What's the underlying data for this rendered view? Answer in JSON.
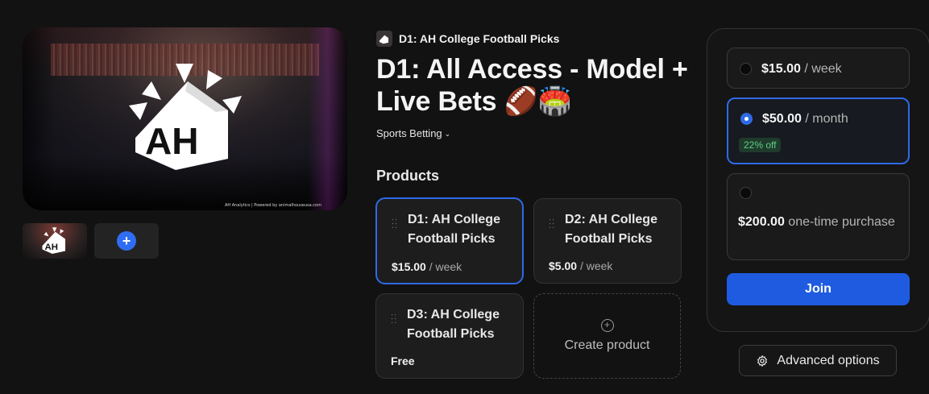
{
  "media": {
    "hero_caption": "AH Analytics | Powered by animalhouseusa.com",
    "hero_logo_text": "AH"
  },
  "brand": {
    "name": "D1: AH College Football Picks"
  },
  "product": {
    "title": "D1: All Access - Model + Live Bets 🏈🏟️",
    "category": "Sports Betting"
  },
  "products_section": {
    "heading": "Products",
    "items": [
      {
        "name": "D1: AH College Football Picks",
        "price": "$15.00",
        "period": "/ week",
        "selected": true
      },
      {
        "name": "D2: AH College Football Picks",
        "price": "$5.00",
        "period": "/ week",
        "selected": false
      },
      {
        "name": "D3: AH College Football Picks",
        "price": "Free",
        "period": "",
        "selected": false
      }
    ],
    "create_label": "Create product"
  },
  "pricing": {
    "options": [
      {
        "price": "$15.00",
        "period": " / week",
        "selected": false
      },
      {
        "price": "$50.00",
        "period": " / month",
        "selected": true,
        "badge": "22% off"
      },
      {
        "price": "$200.00",
        "period": " one-time purchase",
        "selected": false
      }
    ],
    "join_label": "Join",
    "advanced_label": "Advanced options"
  },
  "colors": {
    "accent": "#2e6ae6",
    "background": "#121212",
    "badge_text": "#5fcf85"
  },
  "icons": {
    "plus": "plus-icon",
    "drag": "drag-handle-icon",
    "chevron": "chevron-down-icon",
    "gear": "gear-icon",
    "add_circle": "plus-circle-icon"
  }
}
